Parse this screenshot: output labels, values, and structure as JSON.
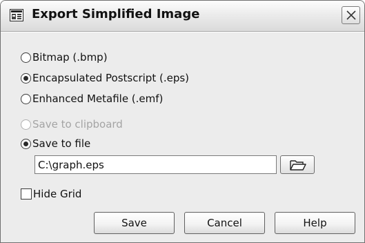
{
  "window": {
    "title": "Export Simplified Image",
    "app_icon": "export-image-icon",
    "close_icon": "close-icon"
  },
  "format_options": [
    {
      "label": "Bitmap (.bmp)",
      "checked": false,
      "enabled": true
    },
    {
      "label": "Encapsulated Postscript (.eps)",
      "checked": true,
      "enabled": true
    },
    {
      "label": "Enhanced Metafile (.emf)",
      "checked": false,
      "enabled": true
    }
  ],
  "destination_options": [
    {
      "label": "Save to clipboard",
      "checked": false,
      "enabled": false
    },
    {
      "label": "Save to file",
      "checked": true,
      "enabled": true
    }
  ],
  "file_path": {
    "value": "C:\\graph.eps",
    "browse_icon": "folder-open-icon"
  },
  "hide_grid": {
    "label": "Hide Grid",
    "checked": false
  },
  "buttons": {
    "save": "Save",
    "cancel": "Cancel",
    "help": "Help"
  }
}
